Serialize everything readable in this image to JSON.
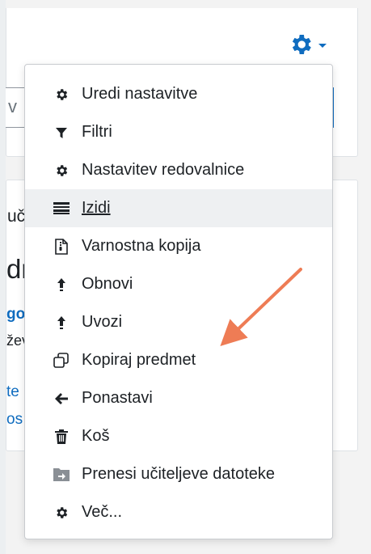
{
  "page": {
    "search_fragment": "v",
    "fragments": {
      "a": "uč",
      "b": "dr",
      "c": "go",
      "d": "žev",
      "e": "te",
      "f": "os"
    }
  },
  "colors": {
    "accent": "#0f6cbf",
    "menu_text": "#1d2125",
    "annotation_arrow": "#ee7c55",
    "active_item_bg": "#eef0f2"
  },
  "header": {
    "settings_icon": "gear-icon",
    "dropdown_caret": "caret-down-icon"
  },
  "menu": {
    "items": [
      {
        "label": "Uredi nastavitve",
        "icon": "gear-icon"
      },
      {
        "label": "Filtri",
        "icon": "filter-icon"
      },
      {
        "label": "Nastavitev redovalnice",
        "icon": "gear-icon"
      },
      {
        "label": "Izidi",
        "icon": "outcomes-icon",
        "active": true
      },
      {
        "label": "Varnostna kopija",
        "icon": "file-archive-icon"
      },
      {
        "label": "Obnovi",
        "icon": "upload-icon"
      },
      {
        "label": "Uvozi",
        "icon": "upload-icon"
      },
      {
        "label": "Kopiraj predmet",
        "icon": "copy-icon"
      },
      {
        "label": "Ponastavi",
        "icon": "arrow-left-icon"
      },
      {
        "label": "Koš",
        "icon": "trash-icon"
      },
      {
        "label": "Prenesi učiteljeve datoteke",
        "icon": "folder-download-icon"
      },
      {
        "label": "Več...",
        "icon": "gear-icon"
      }
    ]
  },
  "annotation": {
    "type": "arrow",
    "points_to": "Kopiraj predmet"
  }
}
